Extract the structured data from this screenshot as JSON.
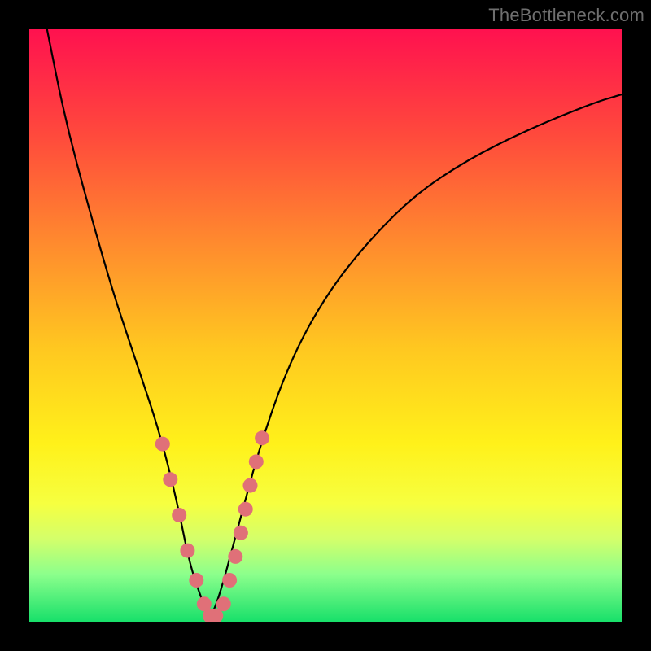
{
  "watermark": {
    "text": "TheBottleneck.com"
  },
  "chart_data": {
    "type": "line",
    "title": "",
    "xlabel": "",
    "ylabel": "",
    "xlim": [
      0,
      100
    ],
    "ylim": [
      0,
      100
    ],
    "grid": false,
    "background_gradient": [
      "#ff114f",
      "#ff4a3c",
      "#ff8a2e",
      "#ffc820",
      "#fff11a",
      "#f6ff40",
      "#d4ff6a",
      "#8cff8c",
      "#18e06a"
    ],
    "series": [
      {
        "name": "bottleneck-curve",
        "x": [
          3,
          6,
          10,
          14,
          18,
          22,
          25,
          27,
          29,
          30.5,
          32,
          35,
          39,
          44,
          50,
          57,
          65,
          74,
          84,
          95,
          100
        ],
        "y": [
          100,
          85,
          70,
          56,
          44,
          32,
          20,
          10,
          4,
          0.5,
          4,
          15,
          30,
          44,
          55,
          64,
          72,
          78,
          83,
          87.5,
          89
        ]
      }
    ],
    "markers": {
      "name": "highlight-points",
      "color": "#e07078",
      "radius_px": 9,
      "x": [
        22.5,
        23.8,
        25.3,
        26.7,
        28.2,
        29.5,
        30.5,
        31.5,
        32.8,
        33.8,
        34.8,
        35.7,
        36.5,
        37.3,
        38.3,
        39.3
      ],
      "y": [
        30,
        24,
        18,
        12,
        7,
        3,
        1,
        1,
        3,
        7,
        11,
        15,
        19,
        23,
        27,
        31
      ]
    }
  }
}
